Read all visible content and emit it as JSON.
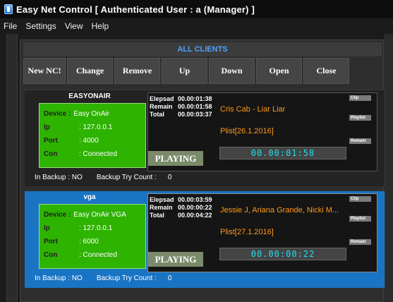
{
  "window": {
    "title": "Easy Net Control  [ Authenticated User : a (Manager) ]"
  },
  "menu": [
    "File",
    "Settings",
    "View",
    "Help"
  ],
  "section_title": "ALL CLIENTS",
  "toolbar": [
    "New NC!",
    "Change",
    "Remove",
    "Up",
    "Down",
    "Open",
    "Close"
  ],
  "labels": {
    "device": "Device :",
    "ip": "Ip",
    "port": "Port",
    "con": "Con",
    "in_backup": "In Backup : NO",
    "backup_try": "Backup Try Count :",
    "elepsad": "Elepsad",
    "remain": "Remain",
    "total": "Total",
    "clip_btn": "Clip",
    "playlist_btn": "Playlist",
    "remain_btn": "Remain"
  },
  "clients": [
    {
      "name": "EASYONAIR",
      "device": "Easy OnAir",
      "ip": ": 127.0.0.1",
      "port": ": 4000",
      "con": ": Connected",
      "backup_count": "0",
      "elapsed": "00.00:01:38",
      "remain": "00.00:01:58",
      "total": "00.00:03:37",
      "song": "Cris Cab - Liar Liar",
      "plist": "Plist[26.1.2016]",
      "status": "PLAYING",
      "timer": "00.00:01:58"
    },
    {
      "name": "vga",
      "device": "Easy OnAir VGA",
      "ip": ": 127.0.0.1",
      "port": ": 6000",
      "con": ": Connected",
      "backup_count": "0",
      "elapsed": "00.00:03:59",
      "remain": "00.00:00:22",
      "total": "00.00:04:22",
      "song": "Jessie J, Ariana Grande, Nicki M...",
      "plist": "Plist[27.1.2016]",
      "status": "PLAYING",
      "timer": "00.00:00:22"
    }
  ]
}
